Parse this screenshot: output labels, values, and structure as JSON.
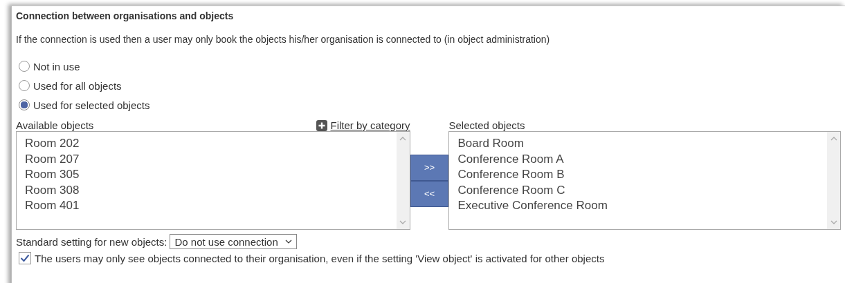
{
  "section": {
    "title": "Connection between organisations and objects",
    "description": "If the connection is used then a user may only book the objects his/her organisation is connected to (in object administration)",
    "options": [
      {
        "label": "Not in use",
        "selected": false
      },
      {
        "label": "Used for all objects",
        "selected": false
      },
      {
        "label": "Used for selected objects",
        "selected": true
      }
    ],
    "available": {
      "label": "Available objects",
      "items": [
        "Room 202",
        "Room 207",
        "Room 305",
        "Room 308",
        "Room 401"
      ]
    },
    "filter_link": "Filter by category",
    "move_buttons": [
      ">>",
      "<<"
    ],
    "selected_list": {
      "label": "Selected objects",
      "items": [
        "Board Room",
        "Conference Room A",
        "Conference Room B",
        "Conference Room C",
        "Executive Conference Room"
      ]
    },
    "standard_setting": {
      "label": "Standard setting for new objects:",
      "value": "Do not use connection"
    },
    "restrict_view": {
      "label": "The users may only see objects connected to their organisation, even if the setting 'View object' is activated for other objects",
      "checked": true
    }
  }
}
